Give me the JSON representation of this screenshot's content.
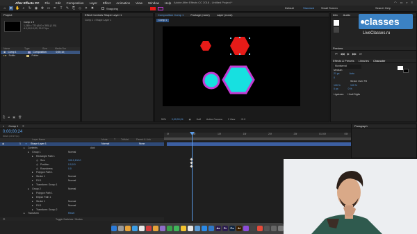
{
  "menubar": {
    "apple": "",
    "app_name": "After Effects CC",
    "items": [
      "File",
      "Edit",
      "Composition",
      "Layer",
      "Effect",
      "Animation",
      "View",
      "Window",
      "Help"
    ],
    "window_title": "Adobe After Effects CC 2018 - Untitled Project *"
  },
  "workspaces": {
    "default": "Default",
    "standard": "Standard",
    "small_screen": "Small Screen",
    "search_help": "Search Help"
  },
  "toolbar": {
    "snapping": "Snapping"
  },
  "project": {
    "tab": "Project",
    "comp_name": "Comp 1 ▾",
    "comp_info": [
      "1,280 x 720 (640 x 360) (1.00)",
      "Δ 0;00;10;00, 29.97 fps"
    ],
    "columns": [
      "Name",
      "Type",
      "Size",
      "Media Dur"
    ],
    "rows": [
      {
        "name": "Comp 1",
        "type": "Composition",
        "dur": "0;00;10;",
        "color": "#a6a6d8",
        "selected": true
      },
      {
        "name": "Solids",
        "type": "Folder",
        "dur": "",
        "color": "#d8c37a",
        "selected": false
      }
    ]
  },
  "effect_controls": {
    "tab": "Effect Controls Shape Layer 1",
    "subtitle": "Comp 1 • Shape Layer 1"
  },
  "composition": {
    "tab": "Composition Comp 1",
    "footage_tab": "Footage (none)",
    "layer_tab": "Layer (none)",
    "comp_chip": "Comp 1"
  },
  "viewer_bar": {
    "zoom": "50%",
    "time": "0;00;00;24",
    "quality": "Half",
    "camera": "Active Camera",
    "views": "1 View",
    "offset": "+0.0"
  },
  "shapes": {
    "fill_red": "#e61b18",
    "fill_cyan": "#17e0e0",
    "stroke_magenta": "#c43bd4",
    "selection": "#7ad0f0"
  },
  "info_panel": {
    "tab": "Info",
    "audio_tab": "Audio"
  },
  "preview_panel": {
    "tab": "Preview"
  },
  "effects_presets": {
    "tab": "Effects & Presets",
    "libraries_tab": "Libraries"
  },
  "character": {
    "tab": "Character",
    "font": "Montserrat",
    "style": "Medium",
    "size": "21 px",
    "leading": "Auto",
    "tracking": "0",
    "stroke": "Stroke Over Fill",
    "vscale": "100 %",
    "hscale": "100 %",
    "baseline": "0 px",
    "tsume": "0 %",
    "ligatures": "Ligatures",
    "hindi_digits": "Hindi Digits"
  },
  "paragraph": {
    "tab": "Paragraph"
  },
  "logo": {
    "brand": "classes",
    "site": "LiveClasses.ru"
  },
  "timeline": {
    "tab": "Comp 1",
    "timecode": "0;00;00;24",
    "frame": "00024 (29.97 fps)",
    "columns": [
      "Layer Name",
      "Mode",
      "T",
      "TrkMat",
      "Parent & Link"
    ],
    "layer": {
      "num": "1",
      "name": "Shape Layer 1",
      "mode": "Normal",
      "parent": "None"
    },
    "add_label": "Add:",
    "rows": [
      {
        "indent": 1,
        "text": "Contents",
        "mode": ""
      },
      {
        "indent": 2,
        "text": "Group 1",
        "mode": "Normal"
      },
      {
        "indent": 3,
        "text": "Rectangle Path 1",
        "mode": ""
      },
      {
        "indent": 4,
        "text": "Size",
        "value": "100.0,100.0"
      },
      {
        "indent": 4,
        "text": "Position",
        "value": "0.0,0.0"
      },
      {
        "indent": 4,
        "text": "Roundness",
        "value": "0.0"
      },
      {
        "indent": 3,
        "text": "Polygon Path 1",
        "mode": ""
      },
      {
        "indent": 3,
        "text": "Stroke 1",
        "mode": "Normal"
      },
      {
        "indent": 3,
        "text": "Fill 1",
        "mode": "Normal"
      },
      {
        "indent": 3,
        "text": "Transform: Group 1",
        "mode": ""
      },
      {
        "indent": 2,
        "text": "Group 2",
        "mode": "Normal"
      },
      {
        "indent": 3,
        "text": "Polygon Path 1",
        "mode": ""
      },
      {
        "indent": 3,
        "text": "Ellipse Path 1",
        "mode": ""
      },
      {
        "indent": 3,
        "text": "Stroke 1",
        "mode": "Normal"
      },
      {
        "indent": 3,
        "text": "Fill 1",
        "mode": "Normal"
      },
      {
        "indent": 3,
        "text": "Transform: Group 2",
        "mode": ""
      },
      {
        "indent": 1,
        "text": "Transform",
        "mode": "Reset"
      }
    ],
    "ruler": [
      "0f",
      "05f",
      "10f",
      "15f",
      "20f",
      "25f",
      "01:00f",
      "05f",
      "10f"
    ],
    "bottom_bar": "Toggle Switches / Modes"
  },
  "dock": {
    "apps": [
      {
        "label": "",
        "color": "#2c7bd8"
      },
      {
        "label": "",
        "color": "#9a9a9a"
      },
      {
        "label": "",
        "color": "#e7a33a"
      },
      {
        "label": "",
        "color": "#3d9ee5"
      },
      {
        "label": "",
        "color": "#e9e9e9"
      },
      {
        "label": "",
        "color": "#d23b3b"
      },
      {
        "label": "",
        "color": "#e7a33a"
      },
      {
        "label": "",
        "color": "#8f6ec8"
      },
      {
        "label": "",
        "color": "#3aa14a"
      },
      {
        "label": "",
        "color": "#3fb65a"
      },
      {
        "label": "",
        "color": "#f4c430"
      },
      {
        "label": "",
        "color": "#e6e6e6"
      },
      {
        "label": "",
        "color": "#5b9bd5"
      },
      {
        "label": "",
        "color": "#2a8ae8"
      },
      {
        "label": "",
        "color": "#3178c6"
      },
      {
        "label": "Ae",
        "color": "#2b1b4e"
      },
      {
        "label": "Pr",
        "color": "#2b1b4e"
      },
      {
        "label": "Ps",
        "color": "#0f2440"
      },
      {
        "label": "Ai",
        "color": "#3a1e00"
      },
      {
        "label": "",
        "color": "#8c4dd8"
      },
      {
        "label": "",
        "color": "#444"
      },
      {
        "label": "",
        "color": "#e64a3a"
      },
      {
        "label": "",
        "color": "#555"
      },
      {
        "label": "",
        "color": "#666"
      },
      {
        "label": "",
        "color": "#777"
      }
    ]
  }
}
